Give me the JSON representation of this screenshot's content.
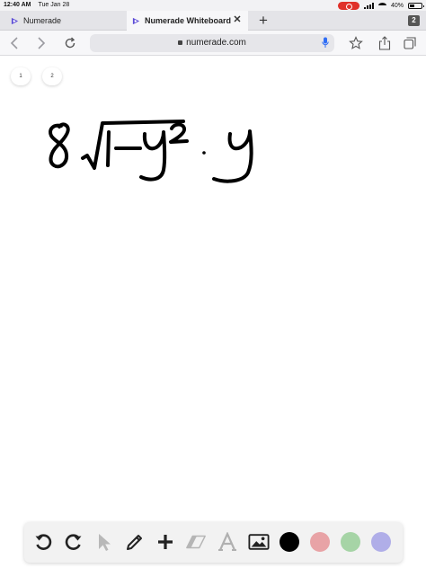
{
  "status_bar": {
    "time": "12:40 AM",
    "date": "Tue Jan 28",
    "battery": "40%"
  },
  "tabs": [
    {
      "label": "Numerade",
      "active": false
    },
    {
      "label": "Numerade Whiteboard",
      "active": true
    }
  ],
  "tab_count": "2",
  "toolbar": {
    "url": "numerade.com"
  },
  "pages": [
    "1",
    "2"
  ],
  "whiteboard": {
    "handwritten_expression": "8√(1-y²)·y"
  },
  "draw_tools": [
    "undo",
    "redo",
    "select",
    "pen",
    "add",
    "eraser",
    "text",
    "image"
  ],
  "colors": {
    "black": "#000000",
    "pink": "#e8a3a6",
    "green": "#a6d4a6",
    "lavender": "#b0aee8"
  }
}
